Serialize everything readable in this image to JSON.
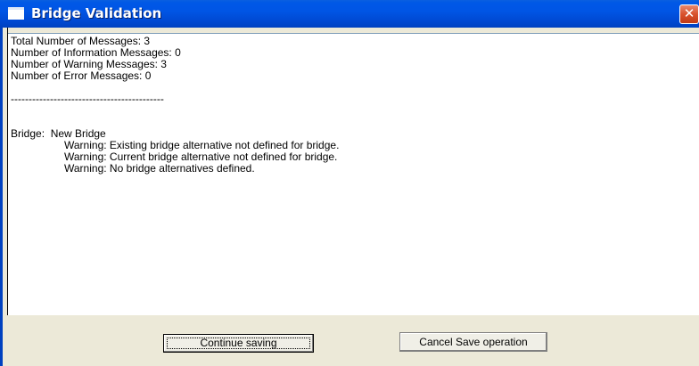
{
  "window": {
    "title": "Bridge Validation",
    "close_label": "✕"
  },
  "messages": {
    "total": "Total Number of Messages: 3",
    "info": "Number of Information Messages: 0",
    "warning": "Number of Warning Messages: 3",
    "error": "Number of Error Messages: 0",
    "separator": "-------------------------------------------",
    "bridge": "Bridge:  New Bridge",
    "warnings": [
      "Warning: Existing bridge alternative not defined for bridge.",
      "Warning: Current bridge alternative not defined for bridge.",
      "Warning: No bridge alternatives defined."
    ]
  },
  "buttons": {
    "continue_label": "Continue saving",
    "cancel_label": "Cancel Save operation"
  },
  "colors": {
    "titlebar": "#0055e5",
    "face": "#ece9d8",
    "close": "#d9512c"
  }
}
